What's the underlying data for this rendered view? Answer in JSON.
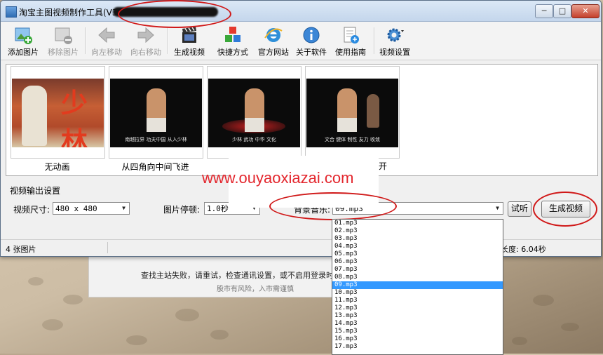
{
  "window": {
    "title": "淘宝主图视频制作工具(V3.",
    "minimize": "─",
    "maximize": "□",
    "close": "✕"
  },
  "toolbar": {
    "items": [
      {
        "label": "添加图片",
        "icon": "add-image-icon",
        "enabled": true
      },
      {
        "label": "移除图片",
        "icon": "remove-image-icon",
        "enabled": false
      },
      {
        "label": "向左移动",
        "icon": "arrow-left-icon",
        "enabled": false
      },
      {
        "label": "向右移动",
        "icon": "arrow-right-icon",
        "enabled": false
      },
      {
        "label": "生成视频",
        "icon": "film-clapper-icon",
        "enabled": true
      },
      {
        "label": "快捷方式",
        "icon": "cubes-icon",
        "enabled": true
      },
      {
        "label": "官方网站",
        "icon": "ie-browser-icon",
        "enabled": true
      },
      {
        "label": "关于软件",
        "icon": "info-icon",
        "enabled": true
      },
      {
        "label": "使用指南",
        "icon": "guide-icon",
        "enabled": true
      },
      {
        "label": "视频设置",
        "icon": "gear-icon",
        "enabled": true
      }
    ]
  },
  "thumbnails": [
    {
      "label": "无动画",
      "caption": ""
    },
    {
      "label": "从四角向中间飞进",
      "caption": "南越拉界 功夫中国 从入少林"
    },
    {
      "label": "",
      "caption": "少林 武功 中华 文化"
    },
    {
      "label": "",
      "caption": "文合 健体 制性 友力 收敛"
    }
  ],
  "poster_text": "少林",
  "overlay": {
    "watermark": "www.ouyaoxiazai.com",
    "fragment": "开"
  },
  "settings": {
    "group_title": "视频输出设置",
    "size_label": "视频尺寸:",
    "size_value": "480 x 480",
    "pause_label": "图片停顿:",
    "pause_value": "1.0秒",
    "music_label": "背景音乐:",
    "music_value": "09.mp3",
    "preview_button": "试听",
    "generate_button": "生成视频"
  },
  "status": {
    "image_count": "4 张图片",
    "duration": "频长度: 6.04秒"
  },
  "banner": {
    "message": "查找主站失败，请重试，检查通讯设置，或不启用登录时查",
    "notice": "股市有风险，入市需谨慎"
  },
  "dropdown": {
    "options": [
      "01.mp3",
      "02.mp3",
      "03.mp3",
      "04.mp3",
      "05.mp3",
      "06.mp3",
      "07.mp3",
      "08.mp3",
      "09.mp3",
      "10.mp3",
      "11.mp3",
      "12.mp3",
      "13.mp3",
      "14.mp3",
      "15.mp3",
      "16.mp3",
      "17.mp3"
    ],
    "selected": "09.mp3"
  },
  "colors": {
    "annotation_red": "#d01818",
    "selection_blue": "#3399ff",
    "watermark_red": "#e3262d"
  }
}
